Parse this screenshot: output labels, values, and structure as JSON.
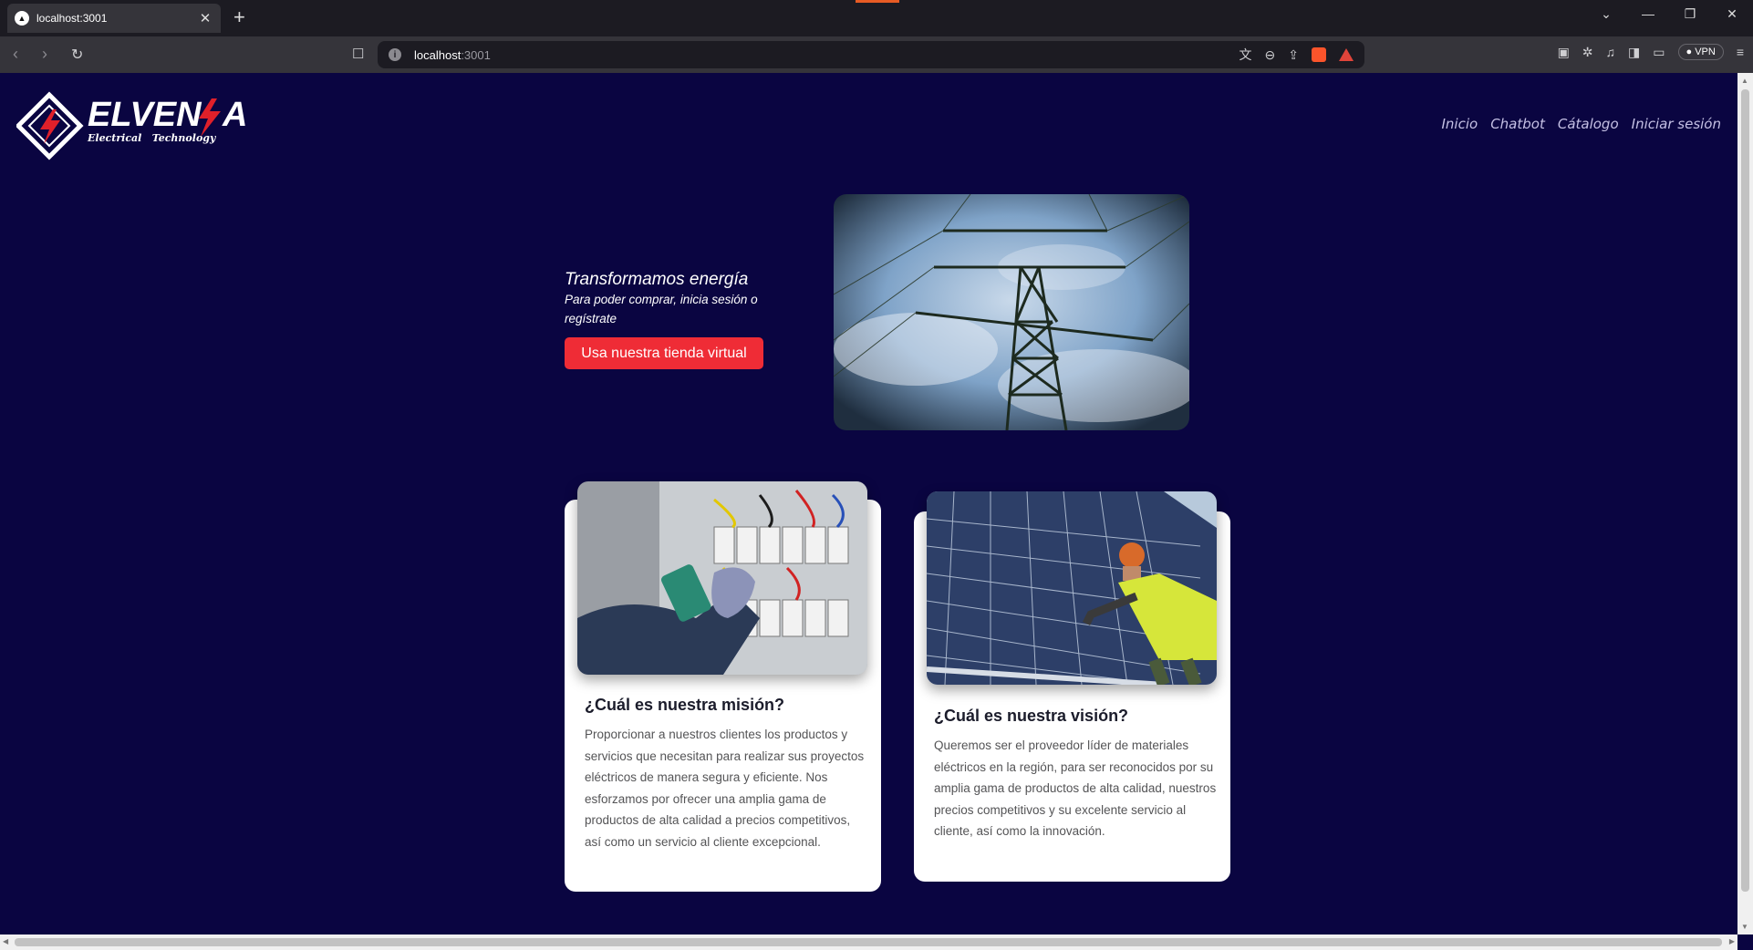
{
  "browser": {
    "tab_title": "localhost:3001",
    "url_host": "localhost",
    "url_port": ":3001",
    "vpn_label": "VPN"
  },
  "site": {
    "logo_text": "ELVENSA",
    "logo_tagline": "Electrical Technology",
    "nav": [
      "Inicio",
      "Chatbot",
      "Cátalogo",
      "Iniciar sesión"
    ]
  },
  "hero": {
    "title": "Transformamos energía",
    "subtitle": "Para poder comprar, inicia sesión o regístrate",
    "cta": "Usa nuestra tienda virtual"
  },
  "cards": [
    {
      "title": "¿Cuál es nuestra misión?",
      "text": "Proporcionar a nuestros clientes los productos y servicios que necesitan para realizar sus proyectos eléctricos de manera segura y eficiente. Nos esforzamos por ofrecer una amplia gama de productos de alta calidad a precios competitivos, así como un servicio al cliente excepcional."
    },
    {
      "title": "¿Cuál es nuestra visión?",
      "text": "Queremos ser el proveedor líder de materiales eléctricos en la región, para ser reconocidos por su amplia gama de productos de alta calidad, nuestros precios competitivos y su excelente servicio al cliente, así como la innovación."
    }
  ],
  "colors": {
    "page_bg": "#0a0541",
    "accent_red": "#ef2c36"
  }
}
